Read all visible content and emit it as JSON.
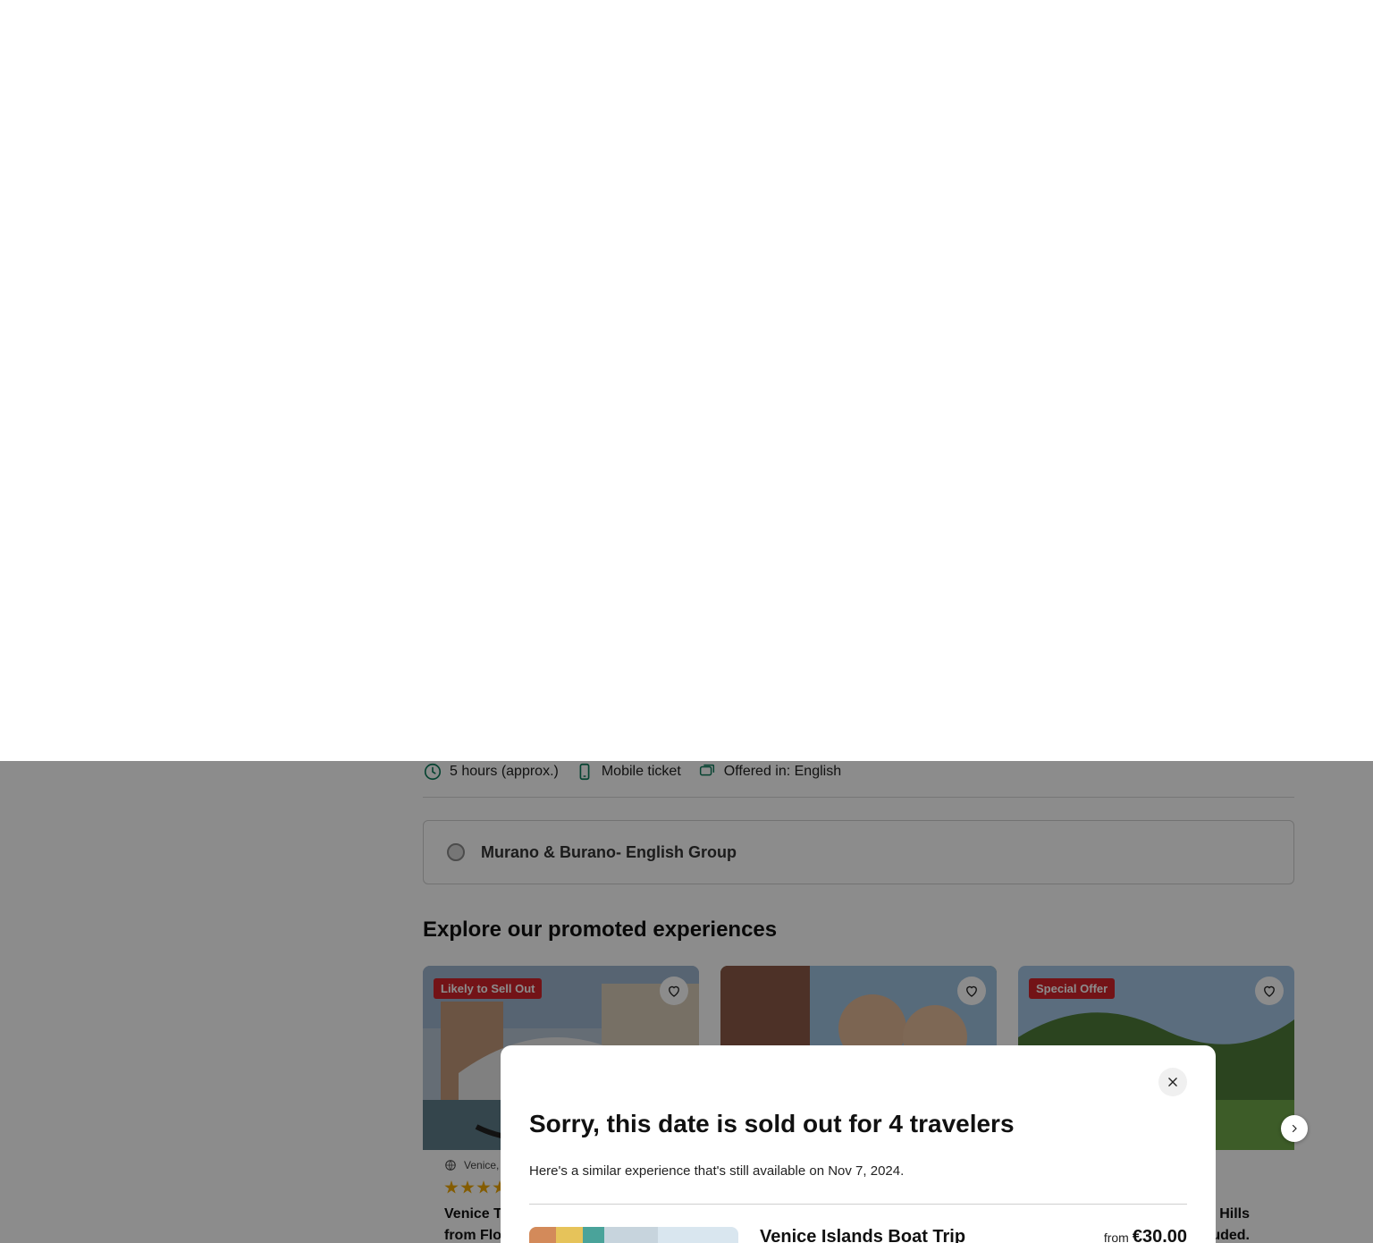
{
  "features": [
    {
      "icon": "clock-icon",
      "label": "5 hours (approx.)"
    },
    {
      "icon": "mobile-icon",
      "label": "Mobile ticket"
    },
    {
      "icon": "chat-icon",
      "label": "Offered in: English"
    }
  ],
  "option": {
    "label": "Murano & Burano- English Group"
  },
  "promoted": {
    "title": "Explore our promoted experiences",
    "cards": [
      {
        "badge": "Likely to Sell Out",
        "location": "Venice,",
        "title_line1": "Venice T",
        "title_line2": "from Flo"
      },
      {
        "badge": "",
        "location": "",
        "title_line1": "",
        "title_line2": ""
      },
      {
        "badge": "Special Offer",
        "location": "",
        "title_line1": "Hills",
        "title_line2": "uded."
      }
    ]
  },
  "modal": {
    "title": "Sorry, this date is sold out for 4 travelers",
    "subtitle": "Here's a similar experience that's still available on Nov 7, 2024.",
    "alt_title": "Venice Islands Boat Trip",
    "alt_from": "from",
    "alt_price": "€30.00"
  },
  "colors": {
    "accent_green": "#0b7a5a",
    "badge_red": "#d1232a",
    "star_yellow": "#f0a800"
  }
}
